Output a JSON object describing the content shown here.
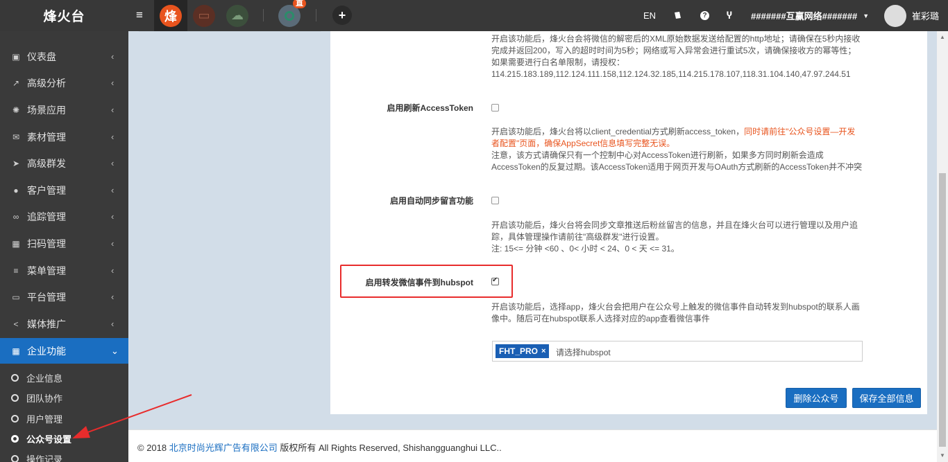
{
  "brand": "烽火台",
  "topbar": {
    "menu_icon": "hamburger-icon",
    "apps": [
      {
        "glyph": "烽",
        "color": "#e8541e"
      },
      {
        "glyph": "▭",
        "color": "#7a3a2a"
      },
      {
        "glyph": "☁",
        "color": "#3a5a3a"
      }
    ],
    "live_badge": "直",
    "plus": "+",
    "lang": "EN",
    "company": "#######互赢网络#######",
    "username": "崔彩璐"
  },
  "sidebar": {
    "items": [
      {
        "icon": "▣",
        "label": "仪表盘"
      },
      {
        "icon": "↗",
        "label": "高级分析"
      },
      {
        "icon": "✺",
        "label": "场景应用"
      },
      {
        "icon": "✉",
        "label": "素材管理"
      },
      {
        "icon": "➤",
        "label": "高级群发"
      },
      {
        "icon": "●",
        "label": "客户管理"
      },
      {
        "icon": "∞",
        "label": "追踪管理"
      },
      {
        "icon": "▦",
        "label": "扫码管理"
      },
      {
        "icon": "≡",
        "label": "菜单管理"
      },
      {
        "icon": "▭",
        "label": "平台管理"
      },
      {
        "icon": "<",
        "label": "媒体推广"
      },
      {
        "icon": "▦",
        "label": "企业功能"
      }
    ],
    "sub_items": [
      {
        "label": "企业信息"
      },
      {
        "label": "团队协作"
      },
      {
        "label": "用户管理"
      },
      {
        "label": "公众号设置"
      },
      {
        "label": "操作记录"
      }
    ]
  },
  "content": {
    "top_help": {
      "line1": "开启该功能后，烽火台会将微信的解密后的XML原始数据发送给配置的http地址；请确保在5秒内接收",
      "line2": "完成并返回200，写入的超时时间为5秒；网络或写入异常会进行重试5次，请确保接收方的幂等性；",
      "line3": "如果需要进行白名单限制，请授权：",
      "line4": "114.215.183.189,112.124.111.158,112.124.32.185,114.215.178.107,118.31.104.140,47.97.244.51"
    },
    "refresh_token": {
      "label": "启用刷新AccessToken",
      "checked": false,
      "help_a": "开启该功能后，烽火台将以client_credential方式刷新access_token，",
      "help_warn1": "同时请前往\"公众号设置—开发",
      "help_warn2": "者配置\"页面，确保AppSecret信息填写完整无误。",
      "help_line3": "注意，该方式请确保只有一个控制中心对AccessToken进行刷新，如果多方同时刷新会造成",
      "help_line4": "AccessToken的反复过期。该AccessToken适用于网页开发与OAuth方式刷新的AccessToken并不冲突"
    },
    "sync_comments": {
      "label": "启用自动同步留言功能",
      "checked": false,
      "help_line1": "开启该功能后，烽火台将会同步文章推送后粉丝留言的信息，并且在烽火台可以进行管理以及用户追",
      "help_line2": "踪，具体管理操作请前往\"高级群发\"进行设置。",
      "help_line3": "注: 15<= 分钟 <60 、0< 小时 < 24、0 < 天 <= 31。"
    },
    "hubspot": {
      "label": "启用转发微信事件到hubspot",
      "checked": true,
      "help_line1": "开启该功能后，选择app，烽火台会把用户在公众号上触发的微信事件自动转发到hubspot的联系人画",
      "help_line2": "像中。随后可在hubspot联系人选择对应的app查看微信事件",
      "tag": "FHT_PRO",
      "tag_remove": "×",
      "placeholder": "请选择hubspot"
    },
    "buttons": {
      "delete": "删除公众号",
      "save": "保存全部信息"
    }
  },
  "footer": {
    "prefix": "© 2018 ",
    "company_link": "北京时尚光辉广告有限公司",
    "suffix": " 版权所有 All Rights Reserved, Shishangguanghui LLC.."
  },
  "colors": {
    "accent": "#1a6ec1",
    "warn": "#e8541e",
    "highlight": "#e82c2c",
    "sidebar_bg": "#3a3a3a"
  }
}
